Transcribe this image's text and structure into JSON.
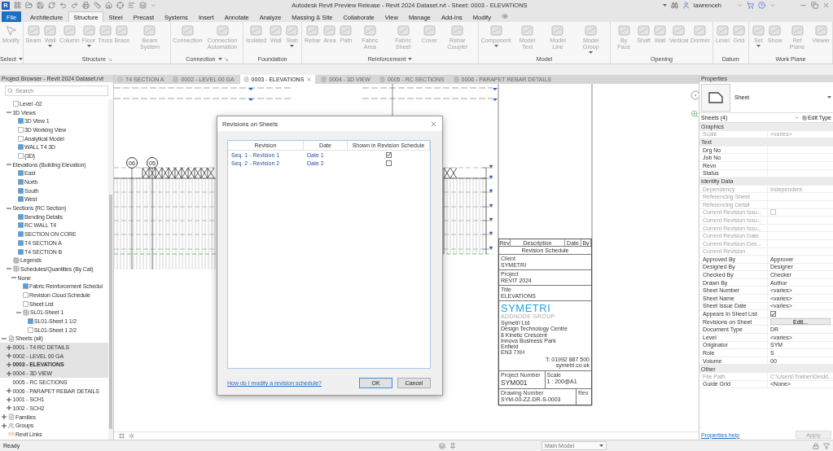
{
  "window": {
    "logo_letter": "R",
    "title": "Autodesk Revit Preview Release - Revit 2024 Dataset.rvt - Sheet: 0003 - ELEVATIONS",
    "user": "lawrenceh"
  },
  "ribbon": {
    "disabled": true,
    "tabs": [
      {
        "label": "File",
        "kind": "file",
        "selected": false
      },
      {
        "label": "Architecture",
        "kind": "tab",
        "selected": false
      },
      {
        "label": "Structure",
        "kind": "tab",
        "selected": true
      },
      {
        "label": "Steel",
        "kind": "tab",
        "selected": false
      },
      {
        "label": "Precast",
        "kind": "tab",
        "selected": false
      },
      {
        "label": "Systems",
        "kind": "tab",
        "selected": false
      },
      {
        "label": "Insert",
        "kind": "tab",
        "selected": false
      },
      {
        "label": "Annotate",
        "kind": "tab",
        "selected": false
      },
      {
        "label": "Analyze",
        "kind": "tab",
        "selected": false
      },
      {
        "label": "Massing & Site",
        "kind": "tab",
        "selected": false
      },
      {
        "label": "Collaborate",
        "kind": "tab",
        "selected": false
      },
      {
        "label": "View",
        "kind": "tab",
        "selected": false
      },
      {
        "label": "Manage",
        "kind": "tab",
        "selected": false
      },
      {
        "label": "Add-Ins",
        "kind": "tab",
        "selected": false
      },
      {
        "label": "Modify",
        "kind": "tab",
        "selected": false
      }
    ],
    "panels": [
      {
        "title": "Select",
        "menu": true,
        "launcher": false,
        "tools": [
          {
            "label": "Modify",
            "menu": false
          }
        ]
      },
      {
        "title": "Structure",
        "menu": false,
        "launcher": true,
        "tools": [
          {
            "label": "Beam",
            "menu": false
          },
          {
            "label": "Wall",
            "menu": true
          },
          {
            "label": "Column",
            "menu": false
          },
          {
            "label": "Floor",
            "menu": true
          },
          {
            "label": "Truss",
            "menu": false
          },
          {
            "label": "Brace",
            "menu": false
          },
          {
            "label": "Beam System",
            "menu": false
          }
        ]
      },
      {
        "title": "Connection",
        "menu": true,
        "launcher": true,
        "tools": [
          {
            "label": "Connection",
            "menu": false
          },
          {
            "label": "Connection Automation",
            "menu": false
          }
        ]
      },
      {
        "title": "Foundation",
        "menu": false,
        "launcher": false,
        "tools": [
          {
            "label": "Isolated",
            "menu": false
          },
          {
            "label": "Wall",
            "menu": false
          },
          {
            "label": "Slab",
            "menu": true
          }
        ]
      },
      {
        "title": "Reinforcement",
        "menu": true,
        "launcher": false,
        "tools": [
          {
            "label": "Rebar",
            "menu": false
          },
          {
            "label": "Area",
            "menu": false
          },
          {
            "label": "Path",
            "menu": false
          },
          {
            "label": "Fabric Area",
            "menu": false
          },
          {
            "label": "Fabric Sheet",
            "menu": false
          },
          {
            "label": "Cover",
            "menu": false
          },
          {
            "label": "Rebar Coupler",
            "menu": false
          }
        ]
      },
      {
        "title": "Model",
        "menu": false,
        "launcher": false,
        "tools": [
          {
            "label": "Component",
            "menu": true
          },
          {
            "label": "Model Text",
            "menu": false
          },
          {
            "label": "Model Line",
            "menu": false
          },
          {
            "label": "Model Group",
            "menu": true
          }
        ]
      },
      {
        "title": "Opening",
        "menu": false,
        "launcher": false,
        "tools": [
          {
            "label": "By Face",
            "menu": false
          },
          {
            "label": "Shaft",
            "menu": false
          },
          {
            "label": "Wall",
            "menu": false
          },
          {
            "label": "Vertical",
            "menu": false
          },
          {
            "label": "Dormer",
            "menu": false
          }
        ]
      },
      {
        "title": "Datum",
        "menu": false,
        "launcher": false,
        "tools": [
          {
            "label": "Level",
            "menu": false
          },
          {
            "label": "Grid",
            "menu": false
          }
        ]
      },
      {
        "title": "Work Plane",
        "menu": false,
        "launcher": false,
        "tools": [
          {
            "label": "Set",
            "menu": true
          },
          {
            "label": "Show",
            "menu": false
          },
          {
            "label": "Ref Plane",
            "menu": false
          },
          {
            "label": "Viewer",
            "menu": false
          }
        ]
      }
    ]
  },
  "browser": {
    "title": "Project Browser - Revit 2024 Dataset.rvt",
    "search": {
      "placeholder": "Search"
    },
    "views": [
      {
        "label": "Level -02",
        "kind": "view",
        "open": false
      },
      {
        "label": "3D Views",
        "expanded": true,
        "children": [
          {
            "label": "3D View 1",
            "kind": "view",
            "open": true
          },
          {
            "label": "3D Working View",
            "kind": "view",
            "open": false
          },
          {
            "label": "Analytical Model",
            "kind": "view",
            "open": false
          },
          {
            "label": "WALL T4 3D",
            "kind": "view",
            "open": true
          },
          {
            "label": "{3D}",
            "kind": "view",
            "open": false
          }
        ]
      },
      {
        "label": "Elevations (Building Elevation)",
        "expanded": true,
        "children": [
          {
            "label": "East",
            "kind": "view",
            "open": true
          },
          {
            "label": "North",
            "kind": "view",
            "open": true
          },
          {
            "label": "South",
            "kind": "view",
            "open": true
          },
          {
            "label": "West",
            "kind": "view",
            "open": true
          }
        ]
      },
      {
        "label": "Sections (RC Section)",
        "expanded": true,
        "children": [
          {
            "label": "Bending Details",
            "kind": "view",
            "open": true
          },
          {
            "label": "RC WALL T4",
            "kind": "view",
            "open": true
          },
          {
            "label": "SECTION ON CORE",
            "kind": "view",
            "open": true
          },
          {
            "label": "T4 SECTION A",
            "kind": "view",
            "open": true
          },
          {
            "label": "T4 SECTION B",
            "kind": "view",
            "open": true
          }
        ]
      },
      {
        "label": "Legends",
        "kind": "legend"
      },
      {
        "label": "Schedules/Quantities (By Cat)",
        "kind": "schedule",
        "expanded": true,
        "children": [
          {
            "label": "None",
            "expanded": true,
            "children": [
              {
                "label": "Fabric Reinforcement Schedul",
                "kind": "view",
                "open": true
              },
              {
                "label": "Revision Cloud Schedule",
                "kind": "view",
                "open": false
              },
              {
                "label": "Sheet List",
                "kind": "view",
                "open": false
              },
              {
                "label": "SL01-Sheet 1",
                "kind": "schedule",
                "expanded": true,
                "children": [
                  {
                    "label": "SL01-Sheet 1 1/2",
                    "kind": "view",
                    "open": true
                  },
                  {
                    "label": "SL01-Sheet 1 2/2",
                    "kind": "view",
                    "open": false
                  }
                ]
              }
            ]
          }
        ]
      }
    ],
    "roots": [
      {
        "label": "Sheets (all)",
        "kind": "sheet",
        "expanded": true,
        "children": [
          {
            "label": "0001 - T4 RC DETAILS",
            "expanded": false,
            "selected": true,
            "current": false
          },
          {
            "label": "0002 - LEVEL 00 GA",
            "expanded": false,
            "selected": true,
            "current": false
          },
          {
            "label": "0003 - ELEVATIONS",
            "expanded": false,
            "selected": true,
            "current": true
          },
          {
            "label": "0004 - 3D VIEW",
            "expanded": false,
            "selected": true,
            "current": false
          },
          {
            "label": "0005 - RC SECTIONS",
            "selected": false,
            "current": false
          },
          {
            "label": "0006 - PARAPET REBAR DETAILS",
            "expanded": false,
            "selected": false,
            "current": false
          },
          {
            "label": "1001 - SCH1",
            "expanded": false,
            "selected": false,
            "current": false
          },
          {
            "label": "1002 - SCH2",
            "expanded": false,
            "selected": false,
            "current": false
          }
        ]
      },
      {
        "label": "Families",
        "kind": "family",
        "expanded": false
      },
      {
        "label": "Groups",
        "kind": "group",
        "expanded": false
      },
      {
        "label": "Revit Links",
        "kind": "link"
      }
    ]
  },
  "view_tabs": [
    {
      "label": "T4 SECTION A",
      "kind": "section",
      "selected": false
    },
    {
      "label": "0002 - LEVEL 00 GA",
      "kind": "sheet",
      "selected": false
    },
    {
      "label": "0003 - ELEVATIONS",
      "kind": "sheet",
      "selected": true
    },
    {
      "label": "0004 - 3D VIEW",
      "kind": "sheet",
      "selected": false
    },
    {
      "label": "0005 - RC SECTIONS",
      "kind": "sheet",
      "selected": false
    },
    {
      "label": "0006 - PARAPET REBAR DETAILS",
      "kind": "sheet",
      "selected": false
    }
  ],
  "sheet": {
    "grid_bubbles": [
      "06",
      "05"
    ],
    "title_block": {
      "revision_columns": [
        "Rev",
        "Description",
        "Date",
        "By"
      ],
      "revision_title": "Revision Schedule",
      "fields": [
        {
          "label": "Client",
          "value": "SYMETRI"
        },
        {
          "label": "Project",
          "value": "REVIT 2024"
        },
        {
          "label": "Title",
          "value": "ELEVATIONS"
        }
      ],
      "logo": "SYMETRI",
      "logo_subtitle": "ADDNODE GROUP",
      "address": [
        "Symetri Ltd",
        "Design Technology Centre",
        "8 Kinetic Crescent",
        "Innova Business Park",
        "Enfield",
        "EN3 7XH"
      ],
      "contact": [
        "T: 01992 887 500",
        "symetri.co.uk"
      ],
      "project_number": {
        "label": "Project Number",
        "value": "SYM001"
      },
      "scale": {
        "label": "Scale",
        "value": "1 : 200@A1"
      },
      "drawing_number": {
        "label": "Drawing Number",
        "value": "SYM-00-ZZ-DR-S-0003"
      },
      "rev": {
        "label": "Rev"
      }
    }
  },
  "dialog": {
    "title": "Revisions on Sheets",
    "columns": [
      "Revision",
      "Date",
      "Shown in Revision Schedule"
    ],
    "rows": [
      {
        "revision": "Seq. 1 - Revision 1",
        "date": "Date 1",
        "shown": true
      },
      {
        "revision": "Seq. 2 - Revision 2",
        "date": "Date 2",
        "shown": false
      }
    ],
    "help_link": "How do I modify a revision schedule?",
    "buttons": [
      {
        "label": "OK",
        "default": true
      },
      {
        "label": "Cancel",
        "default": false
      }
    ]
  },
  "properties": {
    "title": "Properties",
    "type_name": "Sheet",
    "filter": "Sheets (4)",
    "edit_type": "Edit Type",
    "groups": [
      {
        "name": "Graphics",
        "rows": [
          {
            "label": "Scale",
            "kind": "text",
            "value": "<varies>",
            "disabled": true
          }
        ]
      },
      {
        "name": "Text",
        "rows": [
          {
            "label": "Drg No",
            "kind": "text",
            "disabled": false
          },
          {
            "label": "Job No",
            "kind": "text",
            "disabled": false
          },
          {
            "label": "Revn",
            "kind": "text",
            "disabled": false
          },
          {
            "label": "Status",
            "kind": "text",
            "disabled": false
          }
        ]
      },
      {
        "name": "Identity Data",
        "rows": [
          {
            "label": "Dependency",
            "kind": "text",
            "value": "Independent",
            "disabled": true
          },
          {
            "label": "Referencing Sheet",
            "kind": "text",
            "disabled": true
          },
          {
            "label": "Referencing Detail",
            "kind": "text",
            "disabled": true
          },
          {
            "label": "Current Revision Issu...",
            "kind": "checkbox",
            "checked": false,
            "disabled": true
          },
          {
            "label": "Current Revision Issu...",
            "kind": "text",
            "disabled": true
          },
          {
            "label": "Current Revision Issu...",
            "kind": "text",
            "disabled": true
          },
          {
            "label": "Current Revision Date",
            "kind": "text",
            "disabled": true
          },
          {
            "label": "Current Revision Des...",
            "kind": "text",
            "disabled": true
          },
          {
            "label": "Current Revision",
            "kind": "text",
            "disabled": true
          },
          {
            "label": "Approved By",
            "kind": "text",
            "value": "Approver",
            "disabled": false
          },
          {
            "label": "Designed By",
            "kind": "text",
            "value": "Designer",
            "disabled": false
          },
          {
            "label": "Checked By",
            "kind": "text",
            "value": "Checker",
            "disabled": false
          },
          {
            "label": "Drawn By",
            "kind": "text",
            "value": "Author",
            "disabled": false
          },
          {
            "label": "Sheet Number",
            "kind": "text",
            "value": "<varies>",
            "disabled": false
          },
          {
            "label": "Sheet Name",
            "kind": "text",
            "value": "<varies>",
            "disabled": false
          },
          {
            "label": "Sheet Issue Date",
            "kind": "text",
            "value": "<varies>",
            "disabled": false
          },
          {
            "label": "Appears In Sheet List",
            "kind": "checkbox",
            "checked": true,
            "disabled": false
          },
          {
            "label": "Revisions on Sheet",
            "kind": "button",
            "value": "Edit...",
            "disabled": false
          },
          {
            "label": "Document Type",
            "kind": "text",
            "value": "DR",
            "disabled": false
          },
          {
            "label": "Level",
            "kind": "text",
            "value": "<varies>",
            "disabled": false
          },
          {
            "label": "Originator",
            "kind": "text",
            "value": "SYM",
            "disabled": false
          },
          {
            "label": "Role",
            "kind": "text",
            "value": "S",
            "disabled": false
          },
          {
            "label": "Volume",
            "kind": "text",
            "value": "00",
            "disabled": false
          }
        ]
      },
      {
        "name": "Other",
        "rows": [
          {
            "label": "File Path",
            "kind": "text",
            "value": "C:\\Users\\Trainer\\Deskt...",
            "disabled": true
          },
          {
            "label": "Guide Grid",
            "kind": "text",
            "value": "<None>",
            "disabled": false
          }
        ]
      }
    ],
    "help_link": "Properties help",
    "apply": {
      "label": "Apply",
      "disabled": true
    }
  },
  "status_bar": {
    "message": "Ready",
    "workset": "Main Model"
  }
}
